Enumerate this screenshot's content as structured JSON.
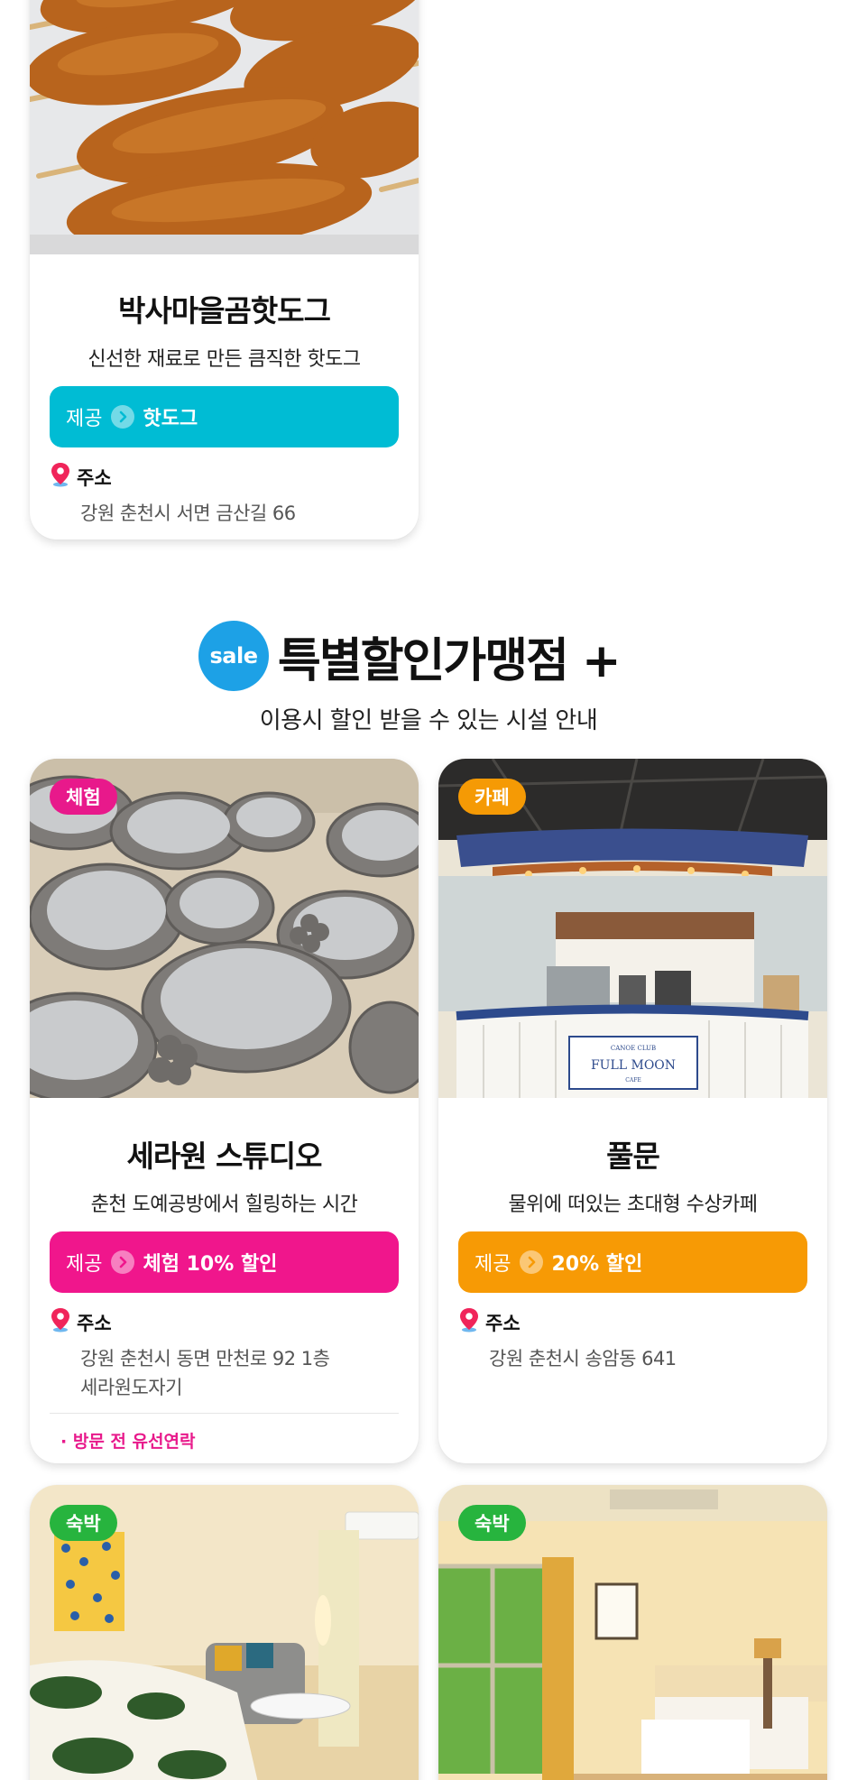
{
  "offer_label": "제공",
  "address_label": "주소",
  "top_card": {
    "title": "박사마을곰핫도그",
    "desc": "신선한 재료로 만든 큼직한 핫도그",
    "offer": "핫도그",
    "address": "강원 춘천시 서면 금산길 66",
    "color": "#00bcd4"
  },
  "section": {
    "badge": "sale",
    "title": "특별할인가맹점 +",
    "subtitle": "이용시 할인 받을 수 있는 시설 안내"
  },
  "stores": [
    {
      "tag": "체험",
      "tag_color": "#e8198b",
      "title": "세라원 스튜디오",
      "desc": "춘천 도예공방에서 힐링하는 시간",
      "offer": "체험 10% 할인",
      "offer_color": "#f0168c",
      "address_line1": "강원 춘천시 동면 만천로 92 1층",
      "address_line2": "세라원도자기",
      "note": "· 방문 전 유선연락"
    },
    {
      "tag": "카페",
      "tag_color": "#f59a05",
      "title": "풀문",
      "desc": "물위에 떠있는 초대형 수상카페",
      "offer": "20% 할인",
      "offer_color": "#f79a05",
      "address_line1": "강원 춘천시 송암동 641",
      "cafe_sign_top": "CANOE CLUB",
      "cafe_sign_main": "FULL MOON",
      "cafe_sign_bottom": "CAFE"
    },
    {
      "tag": "숙박",
      "tag_color": "#27b43e"
    },
    {
      "tag": "숙박",
      "tag_color": "#27b43e"
    }
  ],
  "icons": {
    "location": "location-pin-icon",
    "arrow": "chevron-right-icon"
  }
}
